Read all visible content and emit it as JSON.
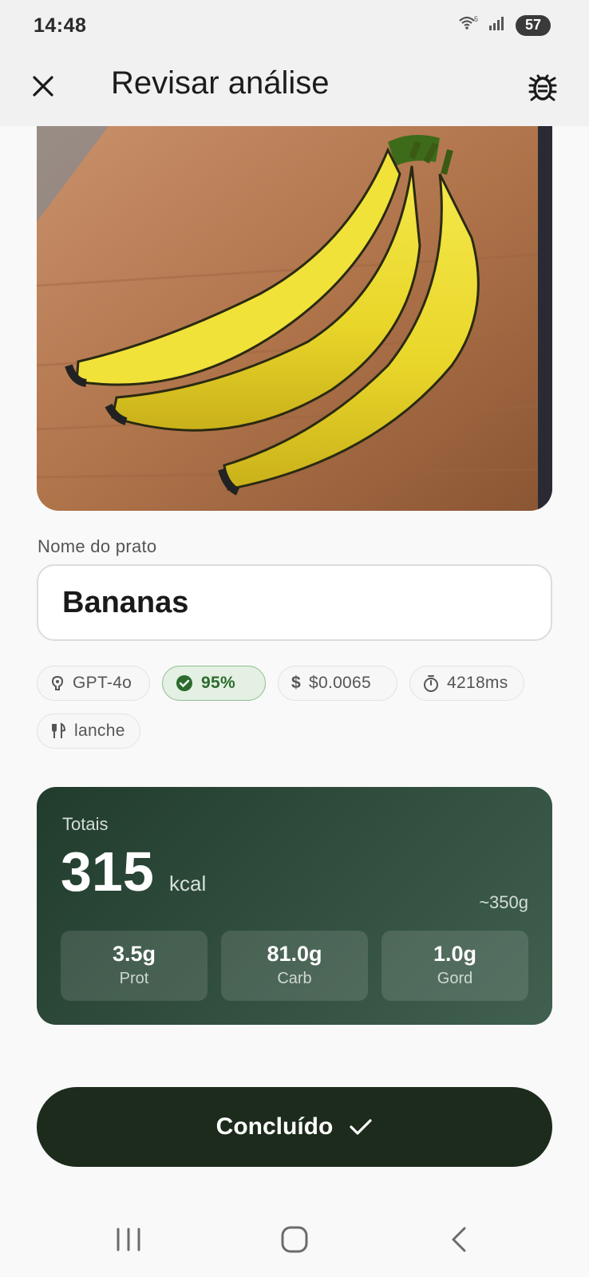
{
  "status_bar": {
    "time": "14:48",
    "wifi_icon": "wifi-icon",
    "signal_icon": "signal-icon",
    "battery": "57"
  },
  "app_bar": {
    "title": "Revisar análise",
    "close_icon": "close-icon",
    "debug_icon": "bug-icon"
  },
  "photo": {
    "subject": "bananas-photo"
  },
  "dish": {
    "label": "Nome do prato",
    "value": "Bananas"
  },
  "chips": [
    {
      "icon": "brain-icon",
      "text": "GPT-4o"
    },
    {
      "icon": "check-circle-icon",
      "text": "95%"
    },
    {
      "icon": "dollar-icon",
      "text": "$0.0065"
    },
    {
      "icon": "timer-icon",
      "text": "4218ms"
    },
    {
      "icon": "utensils-icon",
      "text": "lanche"
    }
  ],
  "totals": {
    "label": "Totais",
    "kcal": "315",
    "unit": "kcal",
    "weight": "~350g",
    "macros": [
      {
        "value": "3.5g",
        "label": "Prot"
      },
      {
        "value": "81.0g",
        "label": "Carb"
      },
      {
        "value": "1.0g",
        "label": "Gord"
      }
    ]
  },
  "done_button": {
    "label": "Concluído",
    "icon": "check-icon"
  },
  "nav": {
    "recents": "recents-icon",
    "home": "home-icon",
    "back": "back-icon"
  },
  "colors": {
    "accent_green": "#2c6b2c",
    "card_dark": "#213c2d",
    "button_dark": "#1c2b1c"
  }
}
